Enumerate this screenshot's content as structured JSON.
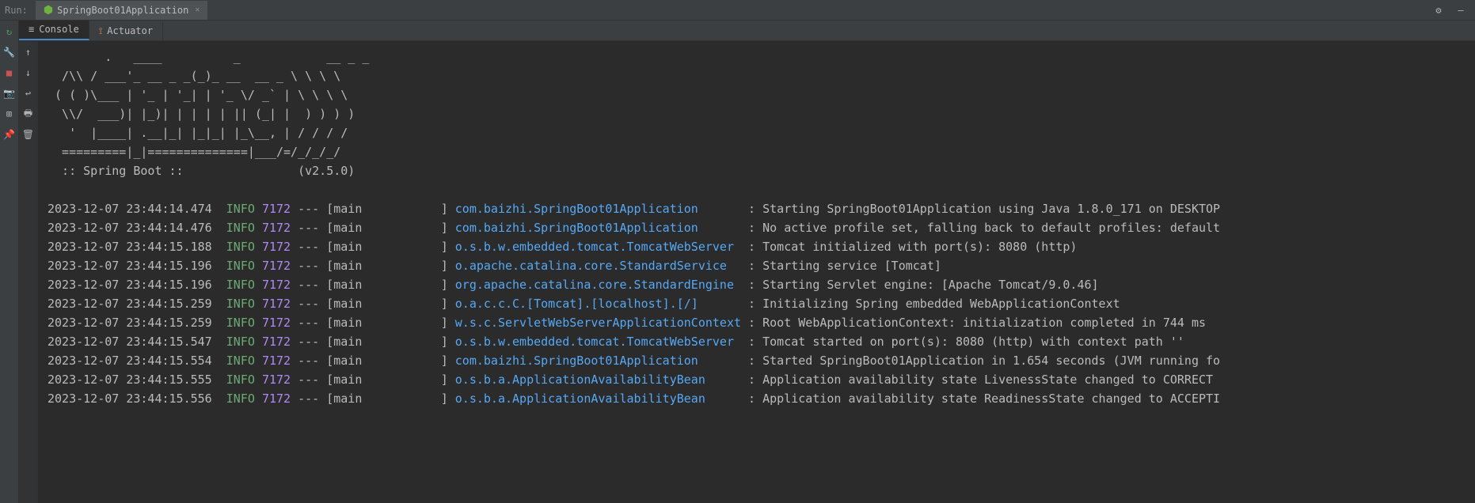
{
  "topBar": {
    "runLabel": "Run:",
    "appName": "SpringBoot01Application"
  },
  "tabs": {
    "console": "Console",
    "actuator": "Actuator"
  },
  "banner": "        .   ____          _            __ _ _\n  /\\\\ / ___'_ __ _ _(_)_ __  __ _ \\ \\ \\ \\\n ( ( )\\___ | '_ | '_| | '_ \\/ _` | \\ \\ \\ \\\n  \\\\/  ___)| |_)| | | | | || (_| |  ) ) ) )\n   '  |____| .__|_| |_|_| |_\\__, | / / / /\n  =========|_|==============|___/=/_/_/_/\n  :: Spring Boot ::                (v2.5.0)\n",
  "logs": [
    {
      "ts": "2023-12-07 23:44:14.474",
      "level": "INFO",
      "pid": "7172",
      "thread": "main",
      "logger": "com.baizhi.SpringBoot01Application",
      "msg": "Starting SpringBoot01Application using Java 1.8.0_171 on DESKTOP"
    },
    {
      "ts": "2023-12-07 23:44:14.476",
      "level": "INFO",
      "pid": "7172",
      "thread": "main",
      "logger": "com.baizhi.SpringBoot01Application",
      "msg": "No active profile set, falling back to default profiles: default"
    },
    {
      "ts": "2023-12-07 23:44:15.188",
      "level": "INFO",
      "pid": "7172",
      "thread": "main",
      "logger": "o.s.b.w.embedded.tomcat.TomcatWebServer",
      "msg": "Tomcat initialized with port(s): 8080 (http)"
    },
    {
      "ts": "2023-12-07 23:44:15.196",
      "level": "INFO",
      "pid": "7172",
      "thread": "main",
      "logger": "o.apache.catalina.core.StandardService",
      "msg": "Starting service [Tomcat]"
    },
    {
      "ts": "2023-12-07 23:44:15.196",
      "level": "INFO",
      "pid": "7172",
      "thread": "main",
      "logger": "org.apache.catalina.core.StandardEngine",
      "msg": "Starting Servlet engine: [Apache Tomcat/9.0.46]"
    },
    {
      "ts": "2023-12-07 23:44:15.259",
      "level": "INFO",
      "pid": "7172",
      "thread": "main",
      "logger": "o.a.c.c.C.[Tomcat].[localhost].[/]",
      "msg": "Initializing Spring embedded WebApplicationContext"
    },
    {
      "ts": "2023-12-07 23:44:15.259",
      "level": "INFO",
      "pid": "7172",
      "thread": "main",
      "logger": "w.s.c.ServletWebServerApplicationContext",
      "msg": "Root WebApplicationContext: initialization completed in 744 ms"
    },
    {
      "ts": "2023-12-07 23:44:15.547",
      "level": "INFO",
      "pid": "7172",
      "thread": "main",
      "logger": "o.s.b.w.embedded.tomcat.TomcatWebServer",
      "msg": "Tomcat started on port(s): 8080 (http) with context path ''"
    },
    {
      "ts": "2023-12-07 23:44:15.554",
      "level": "INFO",
      "pid": "7172",
      "thread": "main",
      "logger": "com.baizhi.SpringBoot01Application",
      "msg": "Started SpringBoot01Application in 1.654 seconds (JVM running fo"
    },
    {
      "ts": "2023-12-07 23:44:15.555",
      "level": "INFO",
      "pid": "7172",
      "thread": "main",
      "logger": "o.s.b.a.ApplicationAvailabilityBean",
      "msg": "Application availability state LivenessState changed to CORRECT"
    },
    {
      "ts": "2023-12-07 23:44:15.556",
      "level": "INFO",
      "pid": "7172",
      "thread": "main",
      "logger": "o.s.b.a.ApplicationAvailabilityBean",
      "msg": "Application availability state ReadinessState changed to ACCEPTI"
    }
  ]
}
